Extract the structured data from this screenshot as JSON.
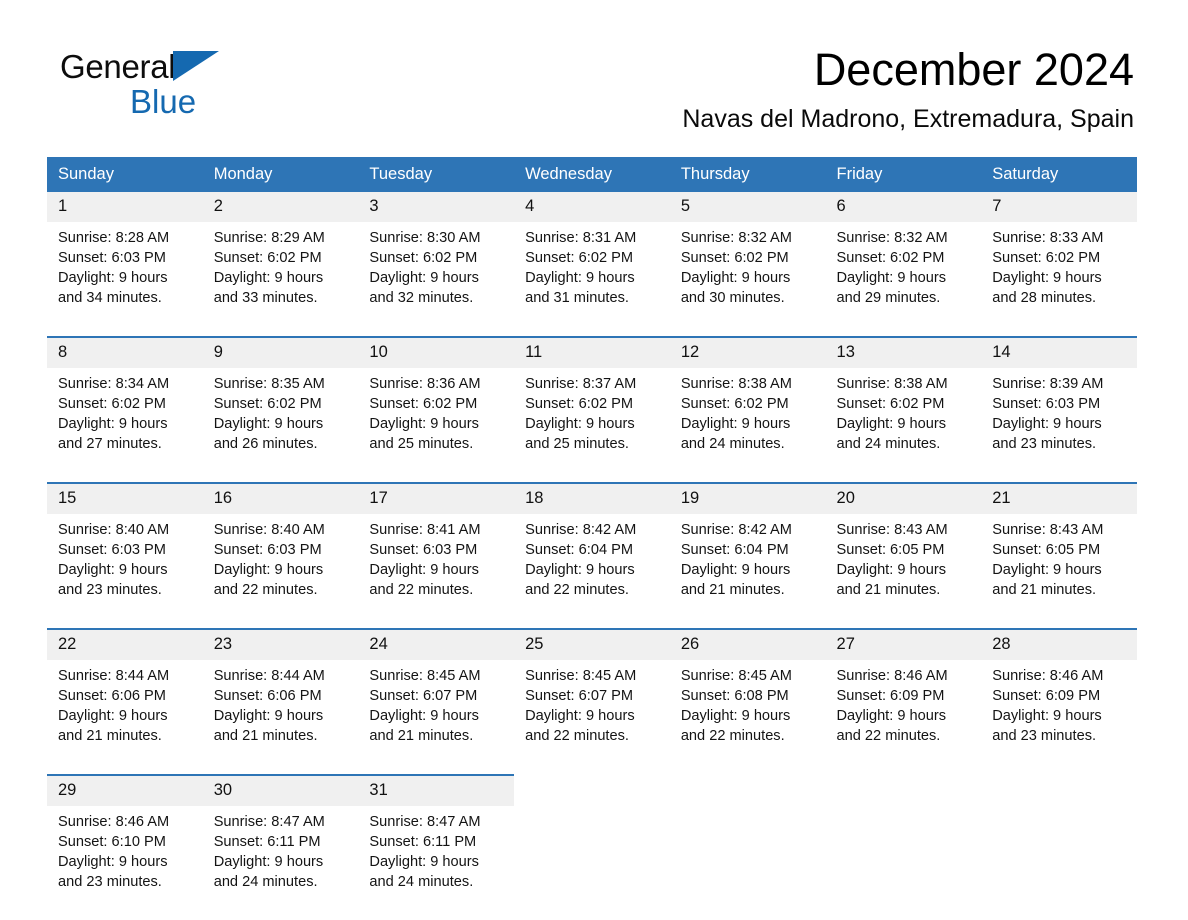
{
  "brand": {
    "name_part1": "General",
    "name_part2": "Blue",
    "logo_icon": "triangle-flag-icon",
    "accent_color": "#1569b0"
  },
  "header": {
    "title": "December 2024",
    "subtitle": "Navas del Madrono, Extremadura, Spain"
  },
  "calendar": {
    "header_bg": "#2e75b6",
    "daynum_bg": "#f0f0f0",
    "weekday_headers": [
      "Sunday",
      "Monday",
      "Tuesday",
      "Wednesday",
      "Thursday",
      "Friday",
      "Saturday"
    ],
    "weeks": [
      {
        "days": [
          {
            "date": "1",
            "sunrise": "Sunrise: 8:28 AM",
            "sunset": "Sunset: 6:03 PM",
            "daylight_line1": "Daylight: 9 hours",
            "daylight_line2": "and 34 minutes."
          },
          {
            "date": "2",
            "sunrise": "Sunrise: 8:29 AM",
            "sunset": "Sunset: 6:02 PM",
            "daylight_line1": "Daylight: 9 hours",
            "daylight_line2": "and 33 minutes."
          },
          {
            "date": "3",
            "sunrise": "Sunrise: 8:30 AM",
            "sunset": "Sunset: 6:02 PM",
            "daylight_line1": "Daylight: 9 hours",
            "daylight_line2": "and 32 minutes."
          },
          {
            "date": "4",
            "sunrise": "Sunrise: 8:31 AM",
            "sunset": "Sunset: 6:02 PM",
            "daylight_line1": "Daylight: 9 hours",
            "daylight_line2": "and 31 minutes."
          },
          {
            "date": "5",
            "sunrise": "Sunrise: 8:32 AM",
            "sunset": "Sunset: 6:02 PM",
            "daylight_line1": "Daylight: 9 hours",
            "daylight_line2": "and 30 minutes."
          },
          {
            "date": "6",
            "sunrise": "Sunrise: 8:32 AM",
            "sunset": "Sunset: 6:02 PM",
            "daylight_line1": "Daylight: 9 hours",
            "daylight_line2": "and 29 minutes."
          },
          {
            "date": "7",
            "sunrise": "Sunrise: 8:33 AM",
            "sunset": "Sunset: 6:02 PM",
            "daylight_line1": "Daylight: 9 hours",
            "daylight_line2": "and 28 minutes."
          }
        ]
      },
      {
        "days": [
          {
            "date": "8",
            "sunrise": "Sunrise: 8:34 AM",
            "sunset": "Sunset: 6:02 PM",
            "daylight_line1": "Daylight: 9 hours",
            "daylight_line2": "and 27 minutes."
          },
          {
            "date": "9",
            "sunrise": "Sunrise: 8:35 AM",
            "sunset": "Sunset: 6:02 PM",
            "daylight_line1": "Daylight: 9 hours",
            "daylight_line2": "and 26 minutes."
          },
          {
            "date": "10",
            "sunrise": "Sunrise: 8:36 AM",
            "sunset": "Sunset: 6:02 PM",
            "daylight_line1": "Daylight: 9 hours",
            "daylight_line2": "and 25 minutes."
          },
          {
            "date": "11",
            "sunrise": "Sunrise: 8:37 AM",
            "sunset": "Sunset: 6:02 PM",
            "daylight_line1": "Daylight: 9 hours",
            "daylight_line2": "and 25 minutes."
          },
          {
            "date": "12",
            "sunrise": "Sunrise: 8:38 AM",
            "sunset": "Sunset: 6:02 PM",
            "daylight_line1": "Daylight: 9 hours",
            "daylight_line2": "and 24 minutes."
          },
          {
            "date": "13",
            "sunrise": "Sunrise: 8:38 AM",
            "sunset": "Sunset: 6:02 PM",
            "daylight_line1": "Daylight: 9 hours",
            "daylight_line2": "and 24 minutes."
          },
          {
            "date": "14",
            "sunrise": "Sunrise: 8:39 AM",
            "sunset": "Sunset: 6:03 PM",
            "daylight_line1": "Daylight: 9 hours",
            "daylight_line2": "and 23 minutes."
          }
        ]
      },
      {
        "days": [
          {
            "date": "15",
            "sunrise": "Sunrise: 8:40 AM",
            "sunset": "Sunset: 6:03 PM",
            "daylight_line1": "Daylight: 9 hours",
            "daylight_line2": "and 23 minutes."
          },
          {
            "date": "16",
            "sunrise": "Sunrise: 8:40 AM",
            "sunset": "Sunset: 6:03 PM",
            "daylight_line1": "Daylight: 9 hours",
            "daylight_line2": "and 22 minutes."
          },
          {
            "date": "17",
            "sunrise": "Sunrise: 8:41 AM",
            "sunset": "Sunset: 6:03 PM",
            "daylight_line1": "Daylight: 9 hours",
            "daylight_line2": "and 22 minutes."
          },
          {
            "date": "18",
            "sunrise": "Sunrise: 8:42 AM",
            "sunset": "Sunset: 6:04 PM",
            "daylight_line1": "Daylight: 9 hours",
            "daylight_line2": "and 22 minutes."
          },
          {
            "date": "19",
            "sunrise": "Sunrise: 8:42 AM",
            "sunset": "Sunset: 6:04 PM",
            "daylight_line1": "Daylight: 9 hours",
            "daylight_line2": "and 21 minutes."
          },
          {
            "date": "20",
            "sunrise": "Sunrise: 8:43 AM",
            "sunset": "Sunset: 6:05 PM",
            "daylight_line1": "Daylight: 9 hours",
            "daylight_line2": "and 21 minutes."
          },
          {
            "date": "21",
            "sunrise": "Sunrise: 8:43 AM",
            "sunset": "Sunset: 6:05 PM",
            "daylight_line1": "Daylight: 9 hours",
            "daylight_line2": "and 21 minutes."
          }
        ]
      },
      {
        "days": [
          {
            "date": "22",
            "sunrise": "Sunrise: 8:44 AM",
            "sunset": "Sunset: 6:06 PM",
            "daylight_line1": "Daylight: 9 hours",
            "daylight_line2": "and 21 minutes."
          },
          {
            "date": "23",
            "sunrise": "Sunrise: 8:44 AM",
            "sunset": "Sunset: 6:06 PM",
            "daylight_line1": "Daylight: 9 hours",
            "daylight_line2": "and 21 minutes."
          },
          {
            "date": "24",
            "sunrise": "Sunrise: 8:45 AM",
            "sunset": "Sunset: 6:07 PM",
            "daylight_line1": "Daylight: 9 hours",
            "daylight_line2": "and 21 minutes."
          },
          {
            "date": "25",
            "sunrise": "Sunrise: 8:45 AM",
            "sunset": "Sunset: 6:07 PM",
            "daylight_line1": "Daylight: 9 hours",
            "daylight_line2": "and 22 minutes."
          },
          {
            "date": "26",
            "sunrise": "Sunrise: 8:45 AM",
            "sunset": "Sunset: 6:08 PM",
            "daylight_line1": "Daylight: 9 hours",
            "daylight_line2": "and 22 minutes."
          },
          {
            "date": "27",
            "sunrise": "Sunrise: 8:46 AM",
            "sunset": "Sunset: 6:09 PM",
            "daylight_line1": "Daylight: 9 hours",
            "daylight_line2": "and 22 minutes."
          },
          {
            "date": "28",
            "sunrise": "Sunrise: 8:46 AM",
            "sunset": "Sunset: 6:09 PM",
            "daylight_line1": "Daylight: 9 hours",
            "daylight_line2": "and 23 minutes."
          }
        ]
      },
      {
        "days": [
          {
            "date": "29",
            "sunrise": "Sunrise: 8:46 AM",
            "sunset": "Sunset: 6:10 PM",
            "daylight_line1": "Daylight: 9 hours",
            "daylight_line2": "and 23 minutes."
          },
          {
            "date": "30",
            "sunrise": "Sunrise: 8:47 AM",
            "sunset": "Sunset: 6:11 PM",
            "daylight_line1": "Daylight: 9 hours",
            "daylight_line2": "and 24 minutes."
          },
          {
            "date": "31",
            "sunrise": "Sunrise: 8:47 AM",
            "sunset": "Sunset: 6:11 PM",
            "daylight_line1": "Daylight: 9 hours",
            "daylight_line2": "and 24 minutes."
          },
          {
            "date": "",
            "sunrise": "",
            "sunset": "",
            "daylight_line1": "",
            "daylight_line2": ""
          },
          {
            "date": "",
            "sunrise": "",
            "sunset": "",
            "daylight_line1": "",
            "daylight_line2": ""
          },
          {
            "date": "",
            "sunrise": "",
            "sunset": "",
            "daylight_line1": "",
            "daylight_line2": ""
          },
          {
            "date": "",
            "sunrise": "",
            "sunset": "",
            "daylight_line1": "",
            "daylight_line2": ""
          }
        ]
      }
    ]
  }
}
